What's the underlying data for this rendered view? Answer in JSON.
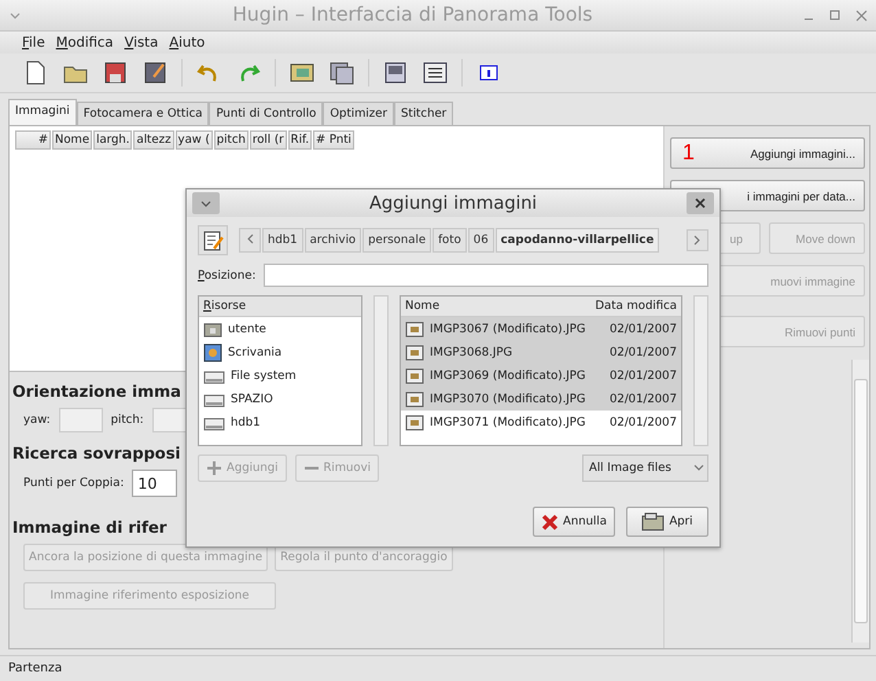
{
  "window": {
    "title": "Hugin – Interfaccia di Panorama Tools"
  },
  "menu": [
    "File",
    "Modifica",
    "Vista",
    "Aiuto"
  ],
  "tabs": [
    {
      "label": "Immagini",
      "selected": true
    },
    {
      "label": "Fotocamera e Ottica",
      "selected": false
    },
    {
      "label": "Punti di Controllo",
      "selected": false
    },
    {
      "label": "Optimizer",
      "selected": false
    },
    {
      "label": "Stitcher",
      "selected": false
    }
  ],
  "table": {
    "columns": [
      "#",
      "Nome",
      "largh.",
      "altezz",
      "yaw (",
      "pitch",
      "roll (r",
      "Rif.",
      "# Pnti"
    ]
  },
  "orientation": {
    "title": "Orientazione imma",
    "yaw_label": "yaw:",
    "pitch_label": "pitch:"
  },
  "overlap": {
    "title": "Ricerca sovrapposi",
    "label": "Punti per Coppia:",
    "value": "10"
  },
  "reference": {
    "title": "Immagine di rifer",
    "buttons": [
      {
        "label": "Ancora la posizione di questa immagine",
        "disabled": true
      },
      {
        "label": "Regola il punto d'ancoraggio",
        "disabled": true
      },
      {
        "label": "Immagine riferimento esposizione",
        "disabled": true
      }
    ]
  },
  "side_buttons": [
    {
      "marker": "1",
      "label": "Aggiungi immagini...",
      "disabled": false
    },
    {
      "label": "i immagini per data...",
      "disabled": false
    },
    {
      "label": "up",
      "disabled": true
    },
    {
      "label": "Move down",
      "disabled": true
    },
    {
      "label": "muovi immagine",
      "disabled": true
    },
    {
      "label": "Rimuovi punti",
      "disabled": true
    }
  ],
  "status_bar": "Partenza",
  "dialog": {
    "title": "Aggiungi immagini",
    "path": [
      {
        "label": "hdb1",
        "selected": false
      },
      {
        "label": "archivio",
        "selected": false
      },
      {
        "label": "personale",
        "selected": false
      },
      {
        "label": "foto",
        "selected": false
      },
      {
        "label": "06",
        "selected": false
      },
      {
        "label": "capodanno-villarpellice",
        "selected": true
      }
    ],
    "location_label": "Posizione:",
    "places_header": "Risorse",
    "places": [
      {
        "name": "utente",
        "kind": "home"
      },
      {
        "name": "Scrivania",
        "kind": "desktop"
      },
      {
        "name": "File system",
        "kind": "drive"
      },
      {
        "name": "SPAZIO",
        "kind": "drive"
      },
      {
        "name": "hdb1",
        "kind": "drive"
      }
    ],
    "columns": [
      "Nome",
      "Data modifica"
    ],
    "files": [
      {
        "name": "IMGP3067 (Modificato).JPG",
        "date": "02/01/2007",
        "selected": true
      },
      {
        "name": "IMGP3068.JPG",
        "date": "02/01/2007",
        "selected": true
      },
      {
        "name": "IMGP3069 (Modificato).JPG",
        "date": "02/01/2007",
        "selected": true
      },
      {
        "name": "IMGP3070 (Modificato).JPG",
        "date": "02/01/2007",
        "selected": true
      },
      {
        "name": "IMGP3071 (Modificato).JPG",
        "date": "02/01/2007",
        "selected": false
      }
    ],
    "add_button": {
      "label": "Aggiungi",
      "disabled": true
    },
    "remove_button": {
      "label": "Rimuovi",
      "disabled": true
    },
    "filter": "All Image files",
    "cancel": "Annulla",
    "open": "Apri"
  }
}
